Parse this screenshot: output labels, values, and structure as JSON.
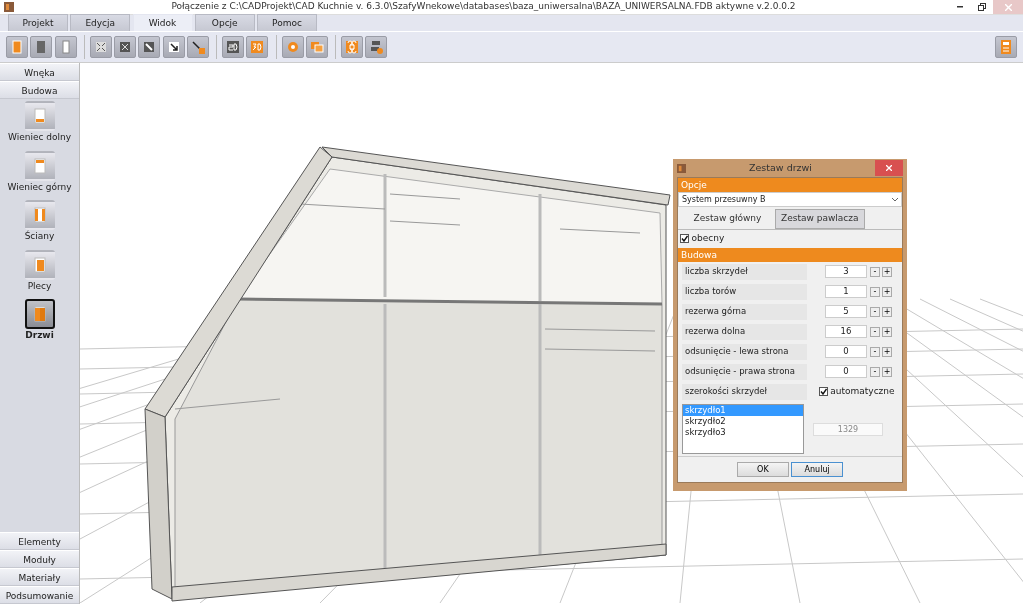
{
  "window": {
    "title": "Połączenie z C:\\CADProjekt\\CAD Kuchnie v. 6.3.0\\SzafyWnekowe\\databases\\baza_uniwersalna\\BAZA_UNIWERSALNA.FDB aktywne  v.2.0.0.2"
  },
  "menu_tabs": [
    {
      "label": "Projekt",
      "selected": false
    },
    {
      "label": "Edycja",
      "selected": false
    },
    {
      "label": "Widok",
      "selected": true
    },
    {
      "label": "Opcje",
      "selected": false
    },
    {
      "label": "Pomoc",
      "selected": false
    }
  ],
  "sidebar": {
    "top_sections": [
      "Wnęka",
      "Budowa"
    ],
    "items": [
      {
        "label": "Wieniec dolny",
        "kind": "bottom",
        "selected": false
      },
      {
        "label": "Wieniec górny",
        "kind": "top",
        "selected": false
      },
      {
        "label": "Ściany",
        "kind": "walls",
        "selected": false
      },
      {
        "label": "Plecy",
        "kind": "back",
        "selected": false
      },
      {
        "label": "Drzwi",
        "kind": "doors",
        "selected": true
      }
    ],
    "bottom_sections": [
      "Elementy",
      "Moduły",
      "Materiały",
      "Podsumowanie"
    ]
  },
  "dialog": {
    "title": "Zestaw drzwi",
    "options_header": "Opcje",
    "system": "System przesuwny B",
    "tabs": [
      {
        "label": "Zestaw główny",
        "selected": true
      },
      {
        "label": "Zestaw pawlacza",
        "selected": false
      }
    ],
    "present": {
      "label": "obecny",
      "checked": true
    },
    "section": "Budowa",
    "params": [
      {
        "label": "liczba skrzydeł",
        "value": "3",
        "minus": "-",
        "plus": "+"
      },
      {
        "label": "liczba torów",
        "value": "1",
        "minus": "-",
        "plus": "+"
      },
      {
        "label": "rezerwa górna",
        "value": "5",
        "minus": "-",
        "plus": "+"
      },
      {
        "label": "rezerwa dolna",
        "value": "16",
        "minus": "-",
        "plus": "+"
      },
      {
        "label": "odsunięcie - lewa strona",
        "value": "0",
        "minus": "-",
        "plus": "+"
      },
      {
        "label": "odsunięcie - prawa strona",
        "value": "0",
        "minus": "-",
        "plus": "+"
      }
    ],
    "widths_label": "szerokości skrzydeł",
    "auto": {
      "label": "automatyczne",
      "checked": true
    },
    "wings": [
      {
        "label": "skrzydło1",
        "selected": true
      },
      {
        "label": "skrzydło2",
        "selected": false
      },
      {
        "label": "skrzydło3",
        "selected": false
      }
    ],
    "width_value": "1329",
    "buttons": [
      {
        "label": "OK",
        "focused": false
      },
      {
        "label": "Anuluj",
        "focused": true
      }
    ]
  }
}
